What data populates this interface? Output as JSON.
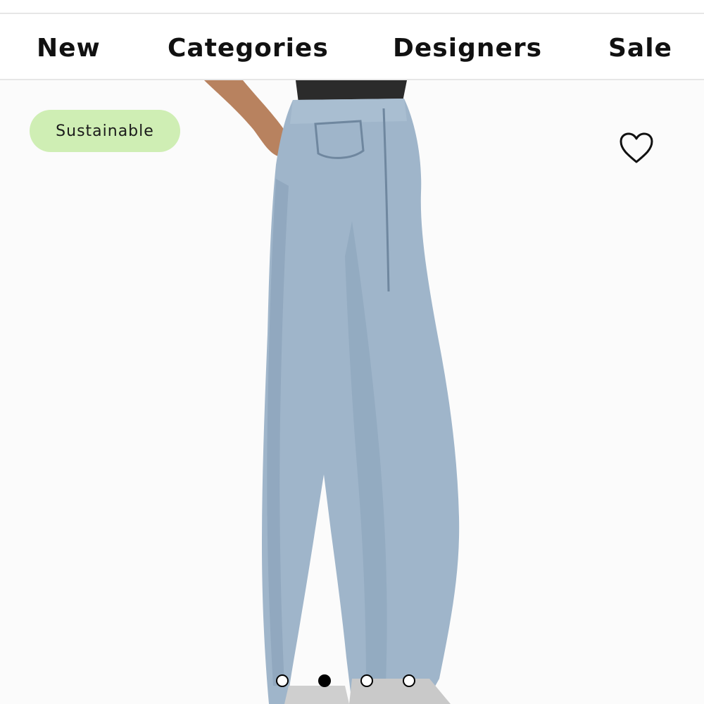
{
  "nav": {
    "items": [
      {
        "label": "New"
      },
      {
        "label": "Categories"
      },
      {
        "label": "Designers"
      },
      {
        "label": "Sale"
      }
    ]
  },
  "product": {
    "badge_label": "Sustainable",
    "favorite_icon": "heart-outline-icon",
    "image_subject": "light-wash high-rise straight-leg jeans",
    "carousel": {
      "total": 4,
      "active_index": 1
    }
  },
  "colors": {
    "badge_bg": "#cfeeb4",
    "nav_text": "#111111",
    "denim": "#9db3c8"
  }
}
